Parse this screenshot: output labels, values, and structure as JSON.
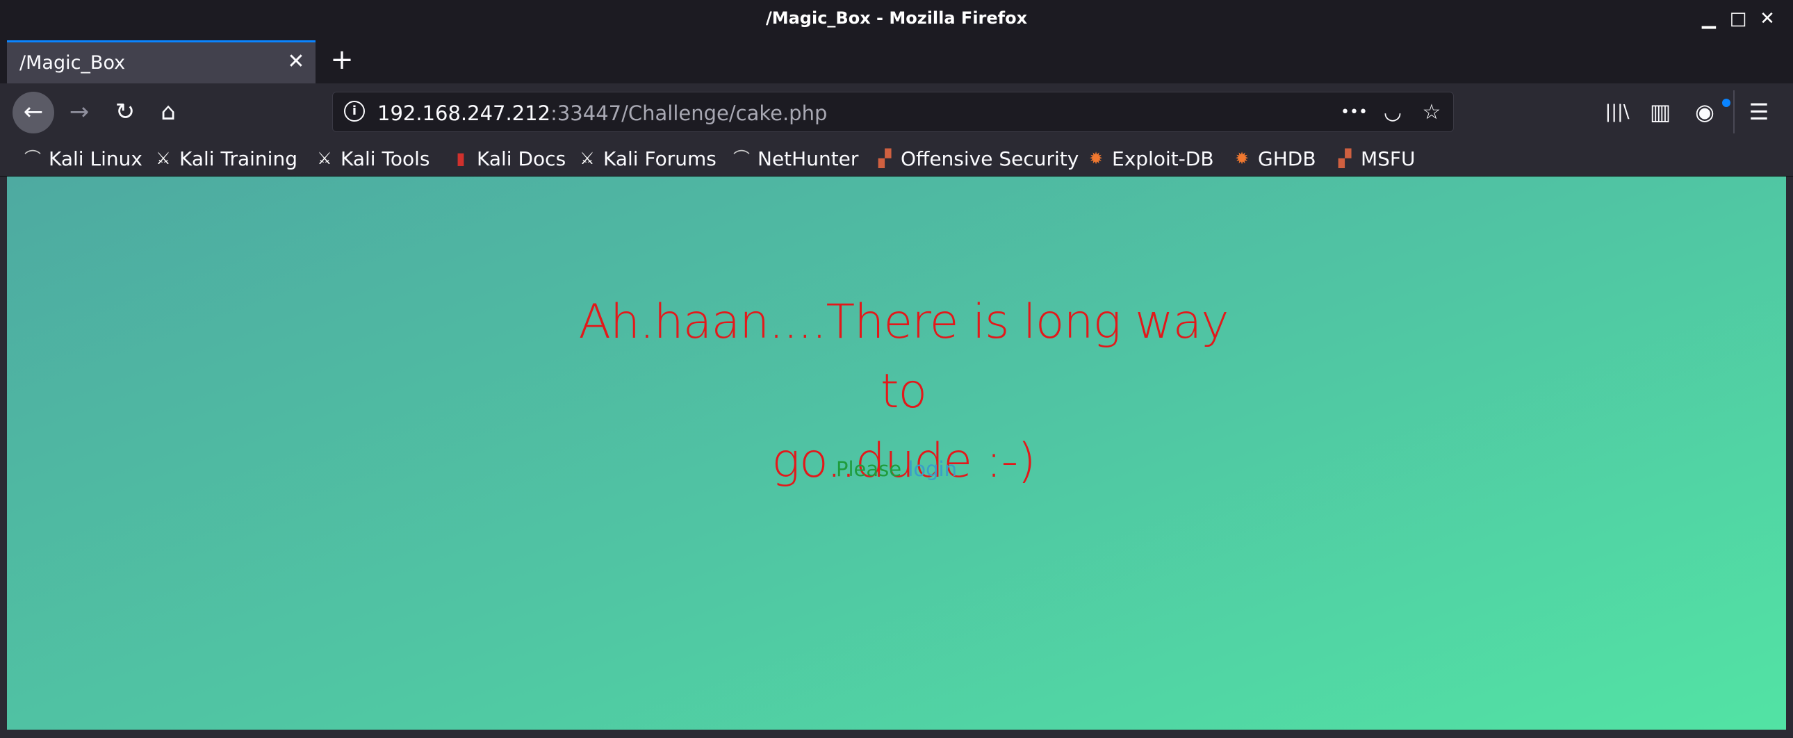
{
  "window": {
    "title": "/Magic_Box - Mozilla Firefox",
    "minimize_glyph": "▁",
    "maximize_glyph": "□",
    "close_glyph": "✕"
  },
  "tabs": [
    {
      "title": "/Magic_Box",
      "active": true,
      "close_glyph": "✕"
    }
  ],
  "new_tab_glyph": "+",
  "nav": {
    "back_glyph": "←",
    "forward_glyph": "→",
    "reload_glyph": "↻",
    "home_glyph": "⌂"
  },
  "urlbar": {
    "info_glyph": "i",
    "host": "192.168.247.212",
    "rest": ":33447/Challenge/cake.php",
    "more_glyph": "•••",
    "pocket_glyph": "◡",
    "bookmark_glyph": "☆"
  },
  "toolbar": {
    "library_glyph": "|||\\",
    "sidebar_glyph": "▥",
    "account_glyph": "◉",
    "menu_glyph": "☰"
  },
  "bookmarks": [
    {
      "label": "Kali Linux",
      "icon": "kali-dragon-icon",
      "glyph": "⌒",
      "color": "#c8c8c8"
    },
    {
      "label": "Kali Training",
      "icon": "kali-sword-icon",
      "glyph": "⚔",
      "color": "#ffffff"
    },
    {
      "label": "Kali Tools",
      "icon": "kali-sword-icon",
      "glyph": "⚔",
      "color": "#ffffff"
    },
    {
      "label": "Kali Docs",
      "icon": "docs-icon",
      "glyph": "▮",
      "color": "#d0312d"
    },
    {
      "label": "Kali Forums",
      "icon": "kali-sword-icon",
      "glyph": "⚔",
      "color": "#ffffff"
    },
    {
      "label": "NetHunter",
      "icon": "kali-dragon-icon",
      "glyph": "⌒",
      "color": "#c8c8c8"
    },
    {
      "label": "Offensive Security",
      "icon": "offsec-icon",
      "glyph": "▞",
      "color": "#d06040"
    },
    {
      "label": "Exploit-DB",
      "icon": "exploit-db-bug-icon",
      "glyph": "✹",
      "color": "#f07830"
    },
    {
      "label": "GHDB",
      "icon": "exploit-db-bug-icon",
      "glyph": "✹",
      "color": "#f07830"
    },
    {
      "label": "MSFU",
      "icon": "msfu-icon",
      "glyph": "▞",
      "color": "#d06040"
    }
  ],
  "page": {
    "headline_line1": "Ah.haan....There is long way to",
    "headline_line2": "go..dude :-)",
    "please_text": "Please",
    "login_link": "login",
    "colors": {
      "headline": "#e3181a",
      "please": "#1f9c3c",
      "link": "#3a9ec8",
      "gradient_start": "#4eaaa1",
      "gradient_end": "#52e3a4"
    }
  }
}
